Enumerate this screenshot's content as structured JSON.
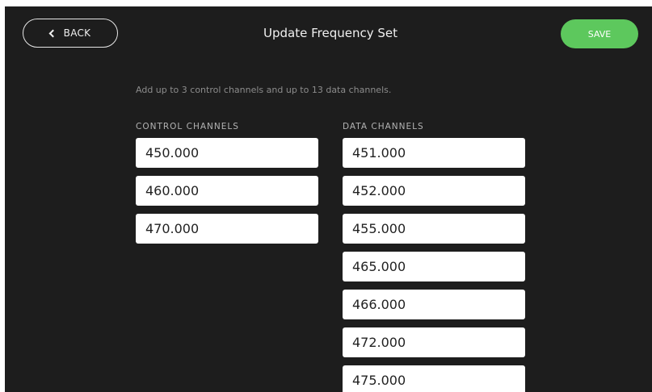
{
  "header": {
    "back_label": "BACK",
    "title": "Update Frequency Set",
    "save_label": "SAVE"
  },
  "instruction": "Add up to 3 control channels and up to 13 data channels.",
  "control_channels": {
    "label": "CONTROL CHANNELS",
    "values": [
      "450.000",
      "460.000",
      "470.000"
    ]
  },
  "data_channels": {
    "label": "DATA CHANNELS",
    "values": [
      "451.000",
      "452.000",
      "455.000",
      "465.000",
      "466.000",
      "472.000",
      "475.000"
    ]
  },
  "colors": {
    "background": "#1d1d1d",
    "accent_save": "#5dc85d",
    "field_bg": "#ffffff"
  }
}
